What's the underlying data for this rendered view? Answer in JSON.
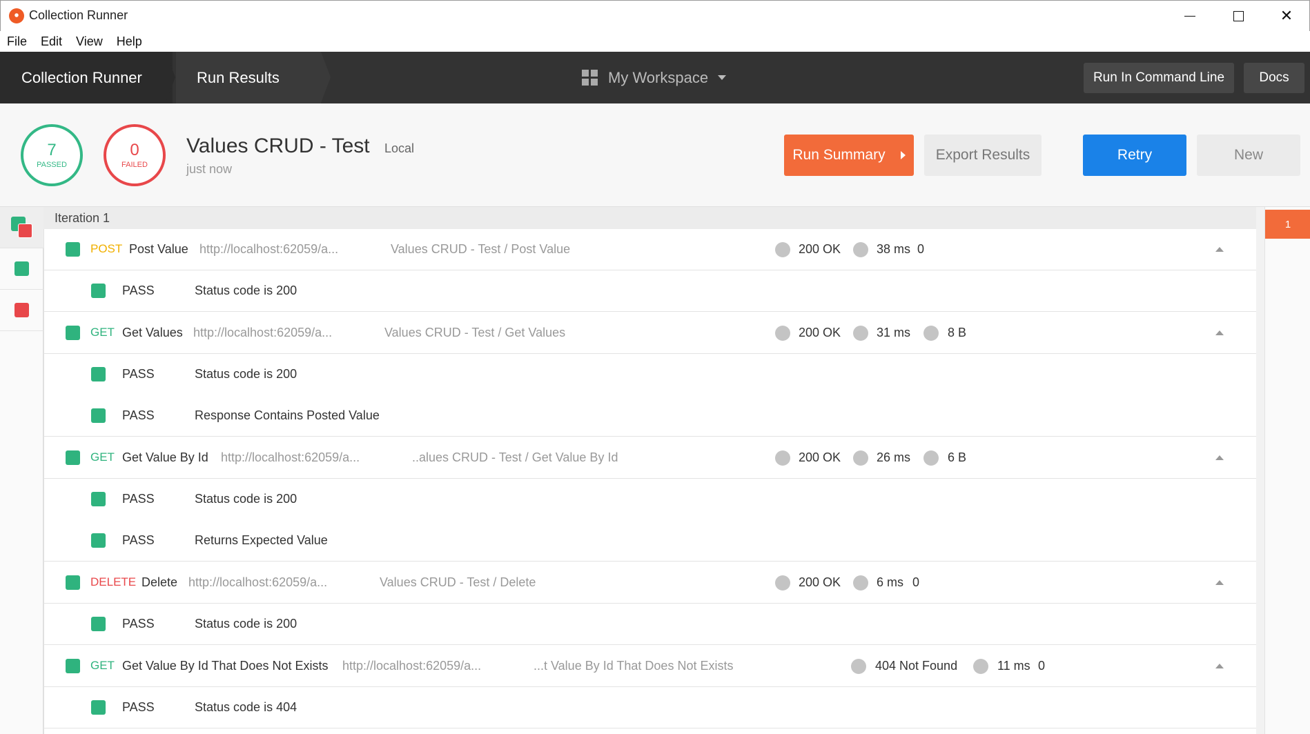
{
  "window": {
    "title": "Collection Runner",
    "minimize": "",
    "maximize": "",
    "close": "✕"
  },
  "menu": [
    "File",
    "Edit",
    "View",
    "Help"
  ],
  "header": {
    "breadcrumb": [
      "Collection Runner",
      "Run Results"
    ],
    "workspace": "My Workspace",
    "cmd_button": "Run In Command Line",
    "docs_button": "Docs"
  },
  "summary": {
    "passed_count": "7",
    "passed_label": "PASSED",
    "failed_count": "0",
    "failed_label": "FAILED",
    "collection": "Values CRUD - Test",
    "environment": "Local",
    "time": "just now",
    "run_summary_button": "Run Summary",
    "export_button": "Export Results",
    "retry_button": "Retry",
    "new_button": "New"
  },
  "colors": {
    "pass": "#2fb37e",
    "fail": "#e8474a",
    "accent": "#f26b3a",
    "primary": "#1a82e8"
  },
  "iteration": {
    "label": "Iteration 1",
    "marker": "1"
  },
  "requests": [
    {
      "method": "POST",
      "name": "Post Value",
      "url": "http://localhost:62059/a...",
      "path": "Values CRUD - Test / Post Value",
      "status": "200 OK",
      "time": "38 ms",
      "size": "0",
      "tests": [
        {
          "result": "PASS",
          "name": "Status code is 200"
        }
      ]
    },
    {
      "method": "GET",
      "name": "Get Values",
      "url": "http://localhost:62059/a...",
      "path": "Values CRUD - Test / Get Values",
      "status": "200 OK",
      "time": "31 ms",
      "size": "8 B",
      "tests": [
        {
          "result": "PASS",
          "name": "Status code is 200"
        },
        {
          "result": "PASS",
          "name": "Response Contains Posted Value"
        }
      ]
    },
    {
      "method": "GET",
      "name": "Get Value By Id",
      "url": "http://localhost:62059/a...",
      "path": "..alues CRUD - Test / Get Value By Id",
      "status": "200 OK",
      "time": "26 ms",
      "size": "6 B",
      "tests": [
        {
          "result": "PASS",
          "name": "Status code is 200"
        },
        {
          "result": "PASS",
          "name": "Returns Expected Value"
        }
      ]
    },
    {
      "method": "DELETE",
      "name": "Delete",
      "url": "http://localhost:62059/a...",
      "path": "Values CRUD - Test / Delete",
      "status": "200 OK",
      "time": "6 ms",
      "size": "0",
      "tests": [
        {
          "result": "PASS",
          "name": "Status code is 200"
        }
      ]
    },
    {
      "method": "GET",
      "name": "Get Value By Id That Does Not Exists",
      "url": "http://localhost:62059/a...",
      "path": "...t Value By Id That Does Not Exists",
      "status": "404 Not Found",
      "time": "11 ms",
      "size": "0",
      "tests": [
        {
          "result": "PASS",
          "name": "Status code is 404"
        }
      ]
    }
  ]
}
